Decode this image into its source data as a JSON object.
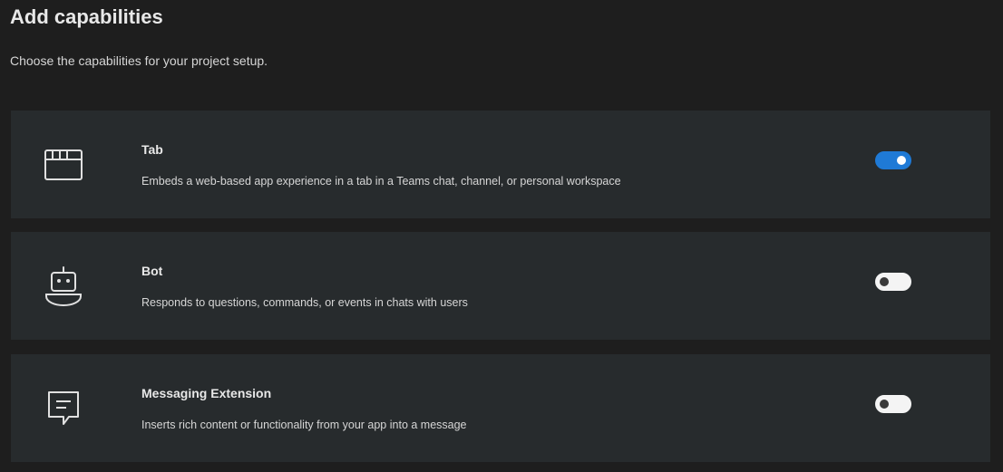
{
  "header": {
    "title": "Add capabilities",
    "subtitle": "Choose the capabilities for your project setup."
  },
  "colors": {
    "background": "#1e1e1e",
    "card": "#272b2d",
    "toggle_on": "#1f7ad6",
    "toggle_off": "#f4f4f4"
  },
  "capabilities": [
    {
      "title": "Tab",
      "description": "Embeds a web-based app experience in a tab in a Teams chat, channel, or personal workspace",
      "icon": "tab-icon",
      "enabled": true
    },
    {
      "title": "Bot",
      "description": "Responds to questions, commands, or events in chats with users",
      "icon": "bot-icon",
      "enabled": false
    },
    {
      "title": "Messaging Extension",
      "description": "Inserts rich content or functionality from your app into a message",
      "icon": "message-icon",
      "enabled": false
    }
  ]
}
